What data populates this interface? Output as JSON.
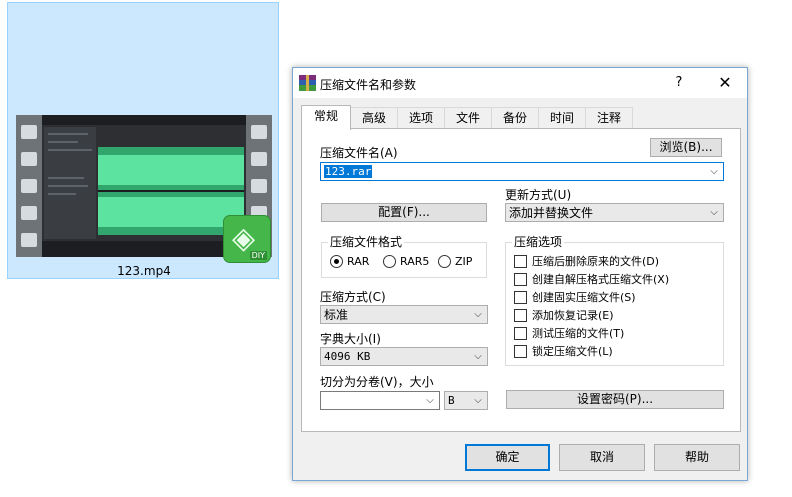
{
  "desktop": {
    "file_name": "123.mp4",
    "badge_text": "DIY"
  },
  "dialog": {
    "title": "压缩文件名和参数",
    "help": "?",
    "close": "✕",
    "tabs": [
      {
        "label": "常规",
        "active": true
      },
      {
        "label": "高级"
      },
      {
        "label": "选项"
      },
      {
        "label": "文件"
      },
      {
        "label": "备份"
      },
      {
        "label": "时间"
      },
      {
        "label": "注释"
      }
    ],
    "archive_name_label": "压缩文件名(A)",
    "browse_button": "浏览(B)...",
    "archive_name_value": "123.rar",
    "update_mode_label": "更新方式(U)",
    "update_mode_value": "添加并替换文件",
    "profiles_button": "配置(F)...",
    "format_group": {
      "title": "压缩文件格式",
      "options": [
        {
          "label": "RAR",
          "selected": true
        },
        {
          "label": "RAR5"
        },
        {
          "label": "ZIP"
        }
      ]
    },
    "options_group": {
      "title": "压缩选项",
      "items": [
        {
          "label": "压缩后删除原来的文件(D)",
          "checked": false
        },
        {
          "label": "创建自解压格式压缩文件(X)",
          "checked": false
        },
        {
          "label": "创建固实压缩文件(S)",
          "checked": false
        },
        {
          "label": "添加恢复记录(E)",
          "checked": false
        },
        {
          "label": "测试压缩的文件(T)",
          "checked": false
        },
        {
          "label": "锁定压缩文件(L)",
          "checked": false
        }
      ]
    },
    "method_label": "压缩方式(C)",
    "method_value": "标准",
    "dict_label": "字典大小(I)",
    "dict_value": "4096 KB",
    "split_label": "切分为分卷(V)，大小",
    "split_value": "",
    "split_unit": "B",
    "password_button": "设置密码(P)...",
    "ok_button": "确定",
    "cancel_button": "取消",
    "help_button": "帮助"
  },
  "colors": {
    "selection": "#0078d7",
    "file_highlight": "#cce8ff",
    "wave": "#5ce3a0",
    "badge": "#45b649"
  }
}
